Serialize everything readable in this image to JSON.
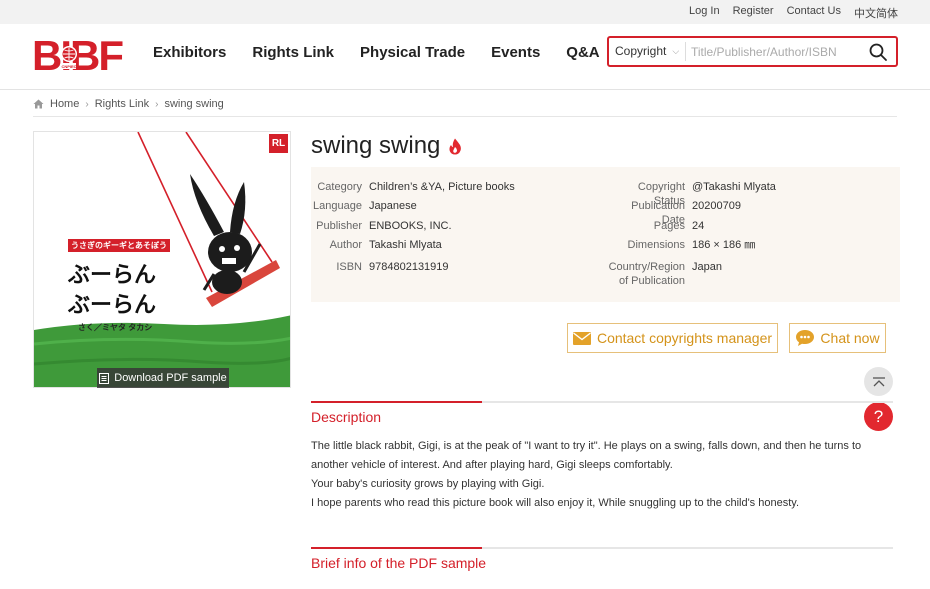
{
  "topbar": {
    "links": [
      "Log In",
      "Register",
      "Contact Us",
      "中文简体"
    ]
  },
  "header": {
    "logo_text": "BIBF",
    "logo_badge": "CNPIEC",
    "nav": [
      "Exhibitors",
      "Rights Link",
      "Physical Trade",
      "Events",
      "Q&A"
    ],
    "search": {
      "scope": "Copyright",
      "placeholder": "Title/Publisher/Author/ISBN"
    }
  },
  "breadcrumb": [
    "Home",
    "Rights Link",
    "swing swing"
  ],
  "book": {
    "title": "swing swing",
    "badge": "RL",
    "cover": {
      "subtitle_jp": "うさぎのギーギとあそぼう",
      "title_jp_line1": "ぶーらん",
      "title_jp_line2": "ぶーらん",
      "author_jp": "さく／ミヤタ タカシ"
    },
    "download_label": "Download PDF sample",
    "info_left": [
      {
        "label": "Category",
        "value": "Children’s &YA, Picture books"
      },
      {
        "label": "Language",
        "value": "Japanese"
      },
      {
        "label": "Publisher",
        "value": "ENBOOKS, INC."
      },
      {
        "label": "Author",
        "value": "Takashi Mlyata"
      },
      {
        "label": "ISBN",
        "value": "9784802131919"
      }
    ],
    "info_right": [
      {
        "label": "Copyright Status",
        "value": "@Takashi Mlyata"
      },
      {
        "label": "Publication Date",
        "value": "20200709"
      },
      {
        "label": "Pages",
        "value": "24"
      },
      {
        "label": "Dimensions",
        "value": "186 × 186 ㎜"
      },
      {
        "label": "Country/Region of Publication",
        "label_line1": "Country/Region",
        "label_line2": "of Publication",
        "value": "Japan"
      }
    ],
    "contact_label": "Contact copyrights manager",
    "chat_label": "Chat now"
  },
  "description": {
    "heading": "Description",
    "paragraphs": [
      "The little black rabbit, Gigi, is at the peak of \"I want to try it\". He plays on a swing, falls down, and then he turns to another vehicle of interest. And after playing hard, Gigi sleeps comfortably.",
      "Your baby's curiosity grows by playing with Gigi.",
      "I hope parents who read this picture book will also enjoy it, While snuggling up to the child's honesty."
    ]
  },
  "pdf_section": {
    "heading": "Brief info of the PDF sample"
  },
  "colors": {
    "brand_red": "#d4202a",
    "cta_orange": "#d4931a",
    "info_bg": "#faf6f1",
    "grass_green": "#3f9a3a"
  }
}
